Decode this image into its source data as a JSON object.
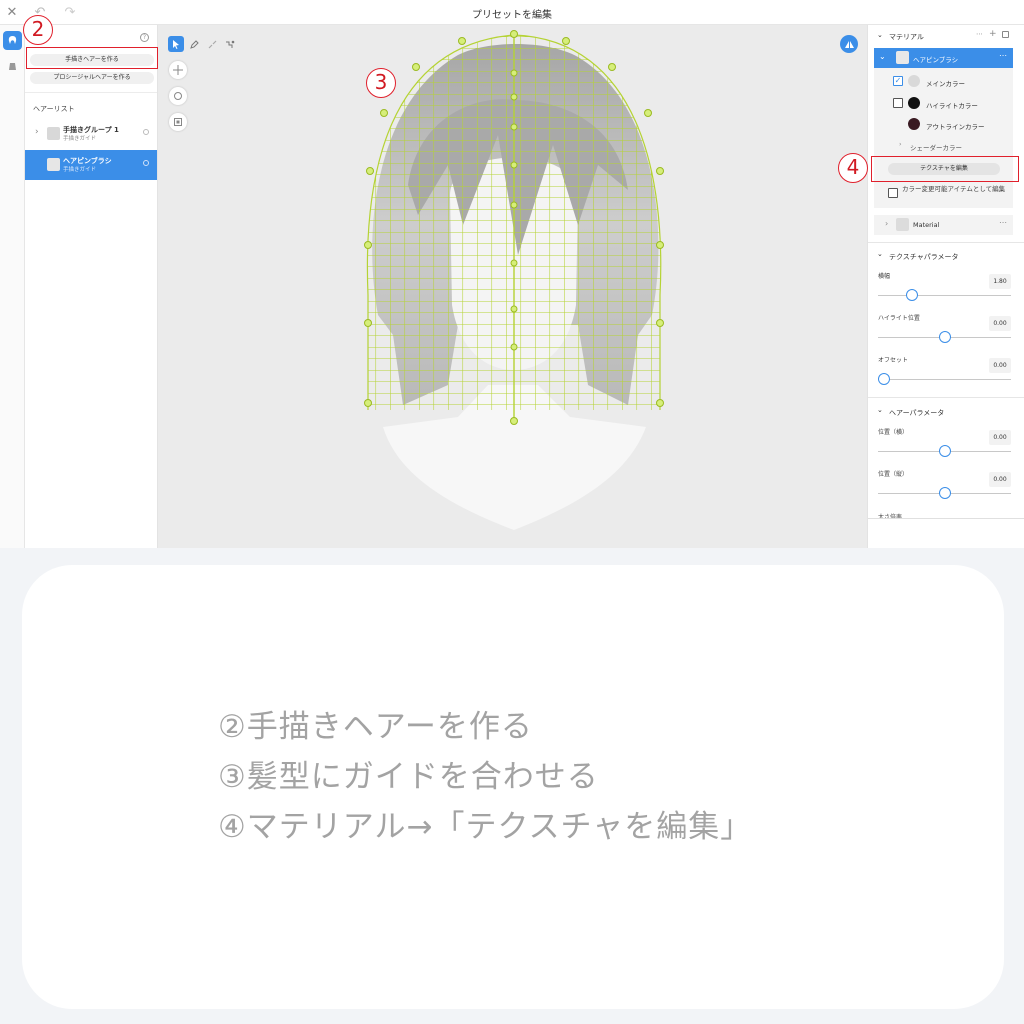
{
  "window": {
    "title": "プリセットを編集"
  },
  "left_panel": {
    "buttons": {
      "create_handdrawn": "手描きヘアーを作る",
      "create_procedural": "プロシージャルヘアーを作る"
    },
    "hair_list_label": "ヘアーリスト",
    "items": [
      {
        "name": "手描きグループ 1",
        "sub": "手描きガイド"
      },
      {
        "name": "ヘアピンブラシ",
        "sub": "手描きガイド"
      }
    ]
  },
  "right_panel": {
    "material_header": "マテリアル",
    "material_item": "ヘアピンブラシ",
    "swatches": {
      "main": "メインカラー",
      "highlight": "ハイライトカラー",
      "outline": "アウトラインカラー",
      "shader": "シェーダーカラー"
    },
    "edit_texture_button": "テクスチャを編集",
    "editable_checkbox_label": "カラー変更可能アイテムとして編集",
    "material2": "Material",
    "texture_params_header": "テクスチャパラメータ",
    "texture_params": [
      {
        "label": "横幅",
        "value": "1.80",
        "fraction": 0.23
      },
      {
        "label": "ハイライト位置",
        "value": "0.00",
        "fraction": 0.5
      },
      {
        "label": "オフセット",
        "value": "0.00",
        "fraction": 0.0
      }
    ],
    "hair_params_header": "ヘアーパラメータ",
    "hair_params": [
      {
        "label": "位置（横）",
        "value": "0.00",
        "fraction": 0.5
      },
      {
        "label": "位置（縦）",
        "value": "0.00",
        "fraction": 0.5
      }
    ],
    "partial_label": "太さ倍率"
  },
  "annotations": {
    "step2": "2",
    "step3": "3",
    "step4": "4"
  },
  "caption": {
    "line2": "②手描きヘアーを作る",
    "line3": "③髪型にガイドを合わせる",
    "line4": "④マテリアル→「テクスチャを編集」"
  },
  "colors": {
    "accent_blue": "#3b8ee8",
    "annotation_red": "#e0202c",
    "guide_green": "#b5d334",
    "main_color": "#d9d9d9",
    "highlight_color": "#111111",
    "outline_color": "#3a1a22"
  },
  "icons": [
    "close-icon",
    "undo-icon",
    "redo-icon",
    "hair-mode-icon",
    "accessory-mode-icon",
    "help-icon",
    "select-tool-icon",
    "pen-tool-icon",
    "brush-tool-icon",
    "rig-tool-icon",
    "move-icon",
    "rotate-icon",
    "frame-icon",
    "mirror-icon",
    "more-icon",
    "add-icon",
    "copy-icon"
  ]
}
